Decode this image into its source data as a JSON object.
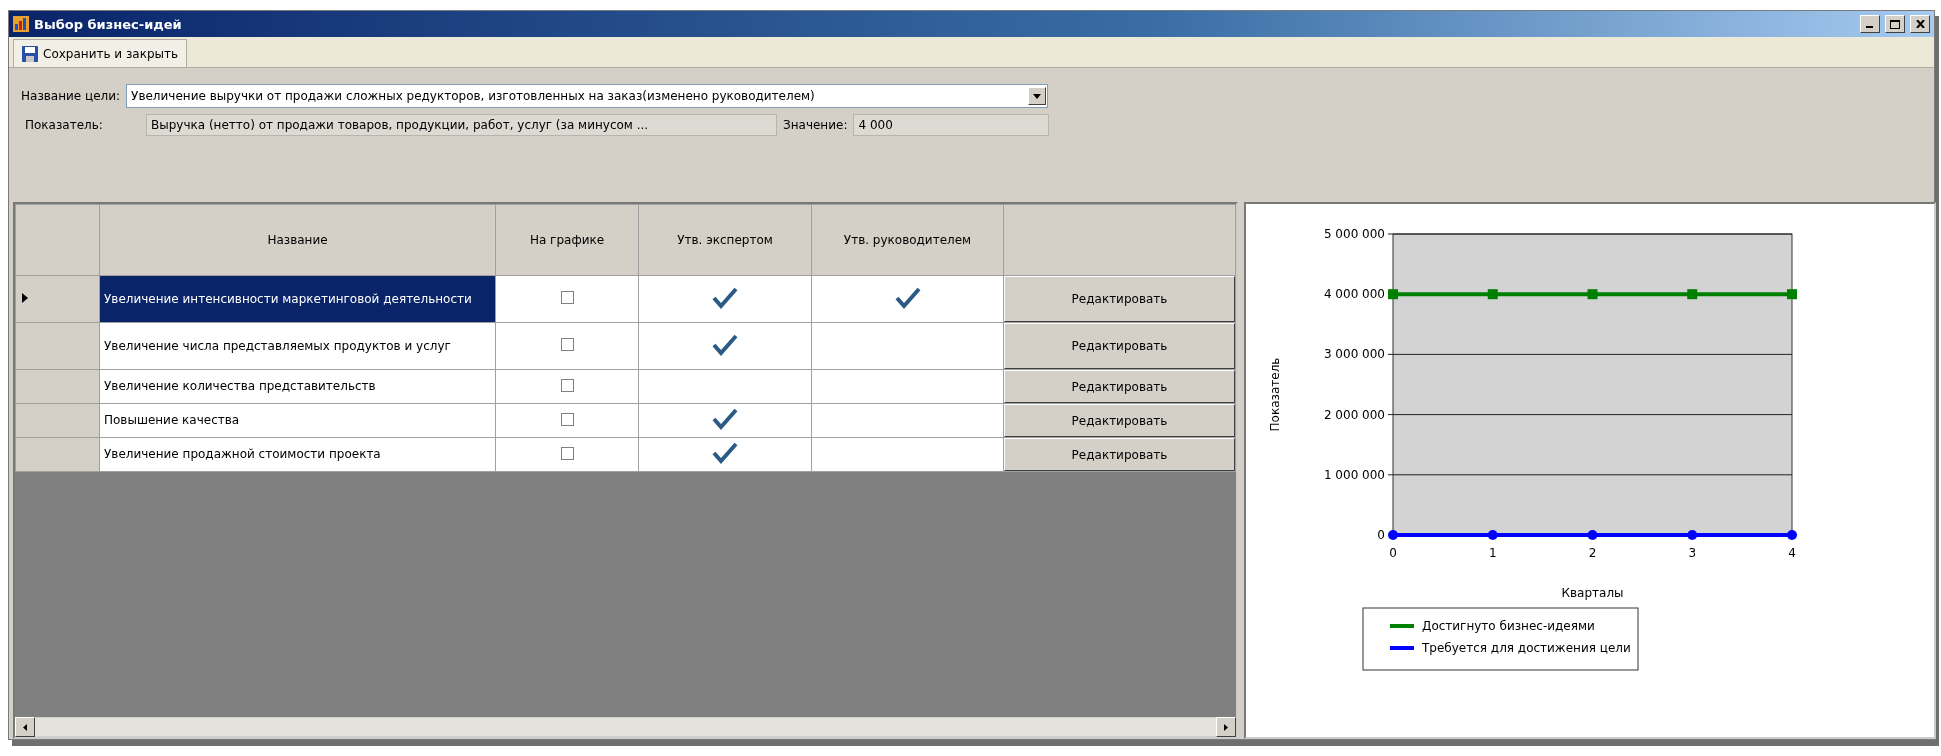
{
  "window": {
    "title": "Выбор бизнес-идей"
  },
  "toolbar": {
    "save_button": "Сохранить и закрыть"
  },
  "form": {
    "goal_label": "Название цели:",
    "goal_value": "Увеличение выручки от продажи сложных редукторов, изготовленных на заказ(изменено руководителем)",
    "indicator_label": "Показатель:",
    "indicator_value": "Выручка (нетто) от продажи товаров, продукции, работ, услуг (за минусом ...",
    "value_label": "Значение:",
    "value_value": "4 000"
  },
  "table": {
    "columns": [
      "Название",
      "На графике",
      "Утв. экспертом",
      "Утв. руководителем"
    ],
    "rows": [
      {
        "name": "Увеличение интенсивности маркетинговой деятельности",
        "on_chart": false,
        "expert_approved": true,
        "manager_approved": true,
        "selected": true,
        "action": "Редактировать"
      },
      {
        "name": "Увеличение числа представляемых продуктов и услуг",
        "on_chart": false,
        "expert_approved": true,
        "manager_approved": false,
        "selected": false,
        "action": "Редактировать"
      },
      {
        "name": "Увеличение количества представительств",
        "on_chart": false,
        "expert_approved": false,
        "manager_approved": false,
        "selected": false,
        "action": "Редактировать"
      },
      {
        "name": "Повышение качества",
        "on_chart": false,
        "expert_approved": true,
        "manager_approved": false,
        "selected": false,
        "action": "Редактировать"
      },
      {
        "name": "Увеличение продажной стоимости проекта",
        "on_chart": false,
        "expert_approved": true,
        "manager_approved": false,
        "selected": false,
        "action": "Редактировать"
      }
    ]
  },
  "chart": {
    "chart_data": {
      "type": "line",
      "xlabel": "Кварталы",
      "ylabel": "Показатель",
      "x": [
        0,
        1,
        2,
        3,
        4
      ],
      "series": [
        {
          "name": "Достигнуто бизнес-идеями",
          "color": "#008000",
          "marker": "square",
          "values": [
            4000000,
            4000000,
            4000000,
            4000000,
            4000000
          ]
        },
        {
          "name": "Требуется для достижения цели",
          "color": "#0000ff",
          "marker": "circle",
          "values": [
            0,
            0,
            0,
            0,
            0
          ]
        }
      ],
      "grid": true,
      "legend": true,
      "xlim": [
        0,
        4
      ],
      "ylim": [
        0,
        5000000
      ],
      "xticks": [
        0,
        1,
        2,
        3,
        4
      ],
      "yticks": [
        {
          "value": 0,
          "label": "0"
        },
        {
          "value": 1000000,
          "label": "1 000 000"
        },
        {
          "value": 2000000,
          "label": "2 000 000"
        },
        {
          "value": 3000000,
          "label": "3 000 000"
        },
        {
          "value": 4000000,
          "label": "4 000 000"
        },
        {
          "value": 5000000,
          "label": "5 000 000"
        }
      ]
    }
  }
}
